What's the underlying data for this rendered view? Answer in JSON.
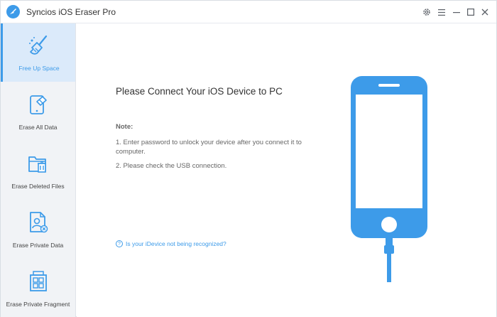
{
  "app": {
    "title": "Syncios iOS Eraser Pro"
  },
  "window_controls": {
    "settings": "gear-icon",
    "menu": "menu-icon",
    "minimize": "minimize-icon",
    "maximize": "maximize-icon",
    "close": "close-icon"
  },
  "sidebar": {
    "items": [
      {
        "label": "Free Up Space",
        "icon": "broom-icon",
        "active": true
      },
      {
        "label": "Erase All Data",
        "icon": "phone-eraser-icon",
        "active": false
      },
      {
        "label": "Erase Deleted Files",
        "icon": "folder-trash-icon",
        "active": false
      },
      {
        "label": "Erase Private Data",
        "icon": "private-file-icon",
        "active": false
      },
      {
        "label": "Erase Private Fragment",
        "icon": "fragment-grid-icon",
        "active": false
      }
    ]
  },
  "main": {
    "heading": "Please Connect Your iOS Device to PC",
    "note_title": "Note:",
    "notes": [
      "1. Enter password to unlock your device after you connect it to computer.",
      "2. Please check the USB connection."
    ],
    "help_link": "Is your iDevice not being recognized?",
    "help_icon": "question-circle-icon",
    "illustration": "iphone-usb-icon"
  },
  "colors": {
    "accent": "#3d9be9",
    "sidebar_bg": "#f1f3f6",
    "active_bg": "#dbeafa"
  }
}
